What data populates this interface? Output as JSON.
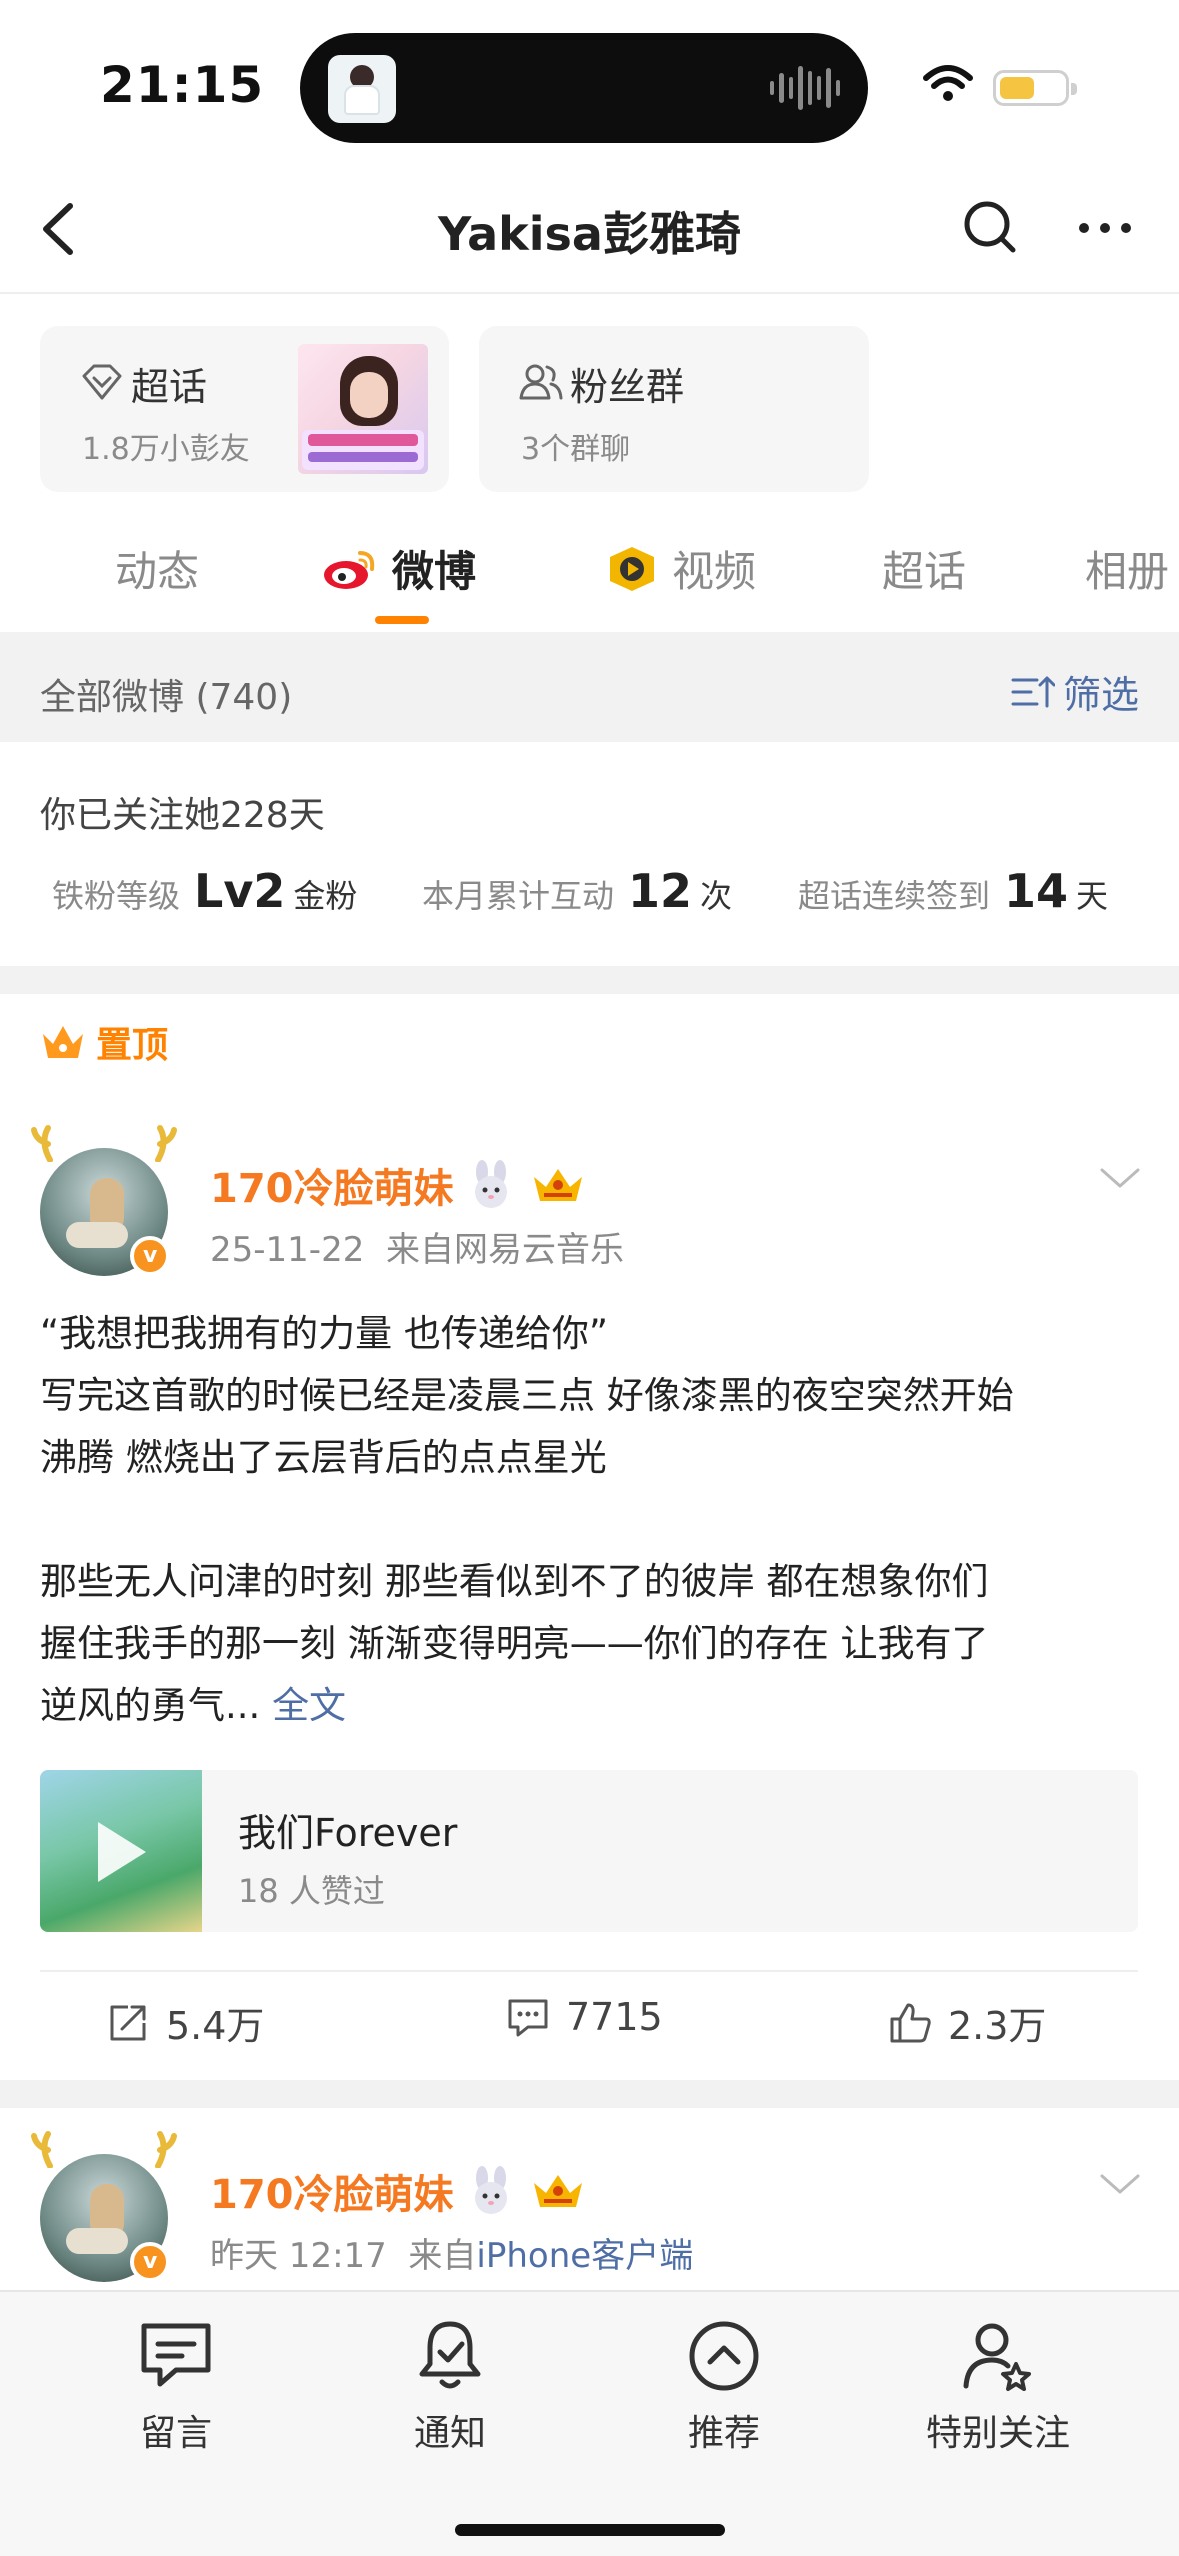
{
  "status_bar": {
    "time": "21:15",
    "battery_color": "#f5c542"
  },
  "header": {
    "title": "Yakisa彭雅琦"
  },
  "cards": [
    {
      "icon": "diamond-icon",
      "title": "超话",
      "subtitle": "1.8万小彭友"
    },
    {
      "icon": "group-icon",
      "title": "粉丝群",
      "subtitle": "3个群聊"
    }
  ],
  "tabs": [
    {
      "label": "动态",
      "active": false
    },
    {
      "label": "微博",
      "active": true,
      "icon": "weibo-logo-icon"
    },
    {
      "label": "视频",
      "active": false,
      "icon": "video-badge-icon"
    },
    {
      "label": "超话",
      "active": false
    },
    {
      "label": "相册",
      "active": false
    }
  ],
  "filter_bar": {
    "label": "全部微博 (740)",
    "filter_label": "筛选"
  },
  "follow_info": {
    "days_text": "你已关注她228天",
    "stats": [
      {
        "label": "铁粉等级",
        "value": "Lv2",
        "unit": "金粉"
      },
      {
        "label": "本月累计互动",
        "value": "12",
        "unit": "次"
      },
      {
        "label": "超话连续签到",
        "value": "14",
        "unit": "天"
      }
    ]
  },
  "pinned_label": "置顶",
  "posts": [
    {
      "author": "170冷脸萌妹",
      "time": "25-11-22",
      "source_prefix": "来自",
      "source": "网易云音乐",
      "text_lines": [
        "“我想把我拥有的力量 也传递给你”",
        "写完这首歌的时候已经是凌晨三点 好像漆黑的夜空突然开始",
        "沸腾 燃烧出了云层背后的点点星光",
        "",
        "那些无人问津的时刻 那些看似到不了的彼岸 都在想象你们",
        "握住我手的那一刻 渐渐变得明亮——你们的存在 让我有了",
        "逆风的勇气..."
      ],
      "more_link": "全文",
      "music": {
        "title": "我们Forever",
        "subtitle": "18 人赞过"
      },
      "actions": {
        "reposts": "5.4万",
        "comments": "7715",
        "likes": "2.3万"
      }
    },
    {
      "author": "170冷脸萌妹",
      "time": "昨天 12:17",
      "source_prefix": "来自",
      "source": "iPhone客户端"
    }
  ],
  "bottom_bar": [
    {
      "label": "留言",
      "icon": "message-icon"
    },
    {
      "label": "通知",
      "icon": "bell-icon"
    },
    {
      "label": "推荐",
      "icon": "chevron-up-circle-icon"
    },
    {
      "label": "特别关注",
      "icon": "user-star-icon"
    }
  ],
  "colors": {
    "accent": "#ff8200",
    "link": "#4e6ea5",
    "username": "#f47920"
  }
}
